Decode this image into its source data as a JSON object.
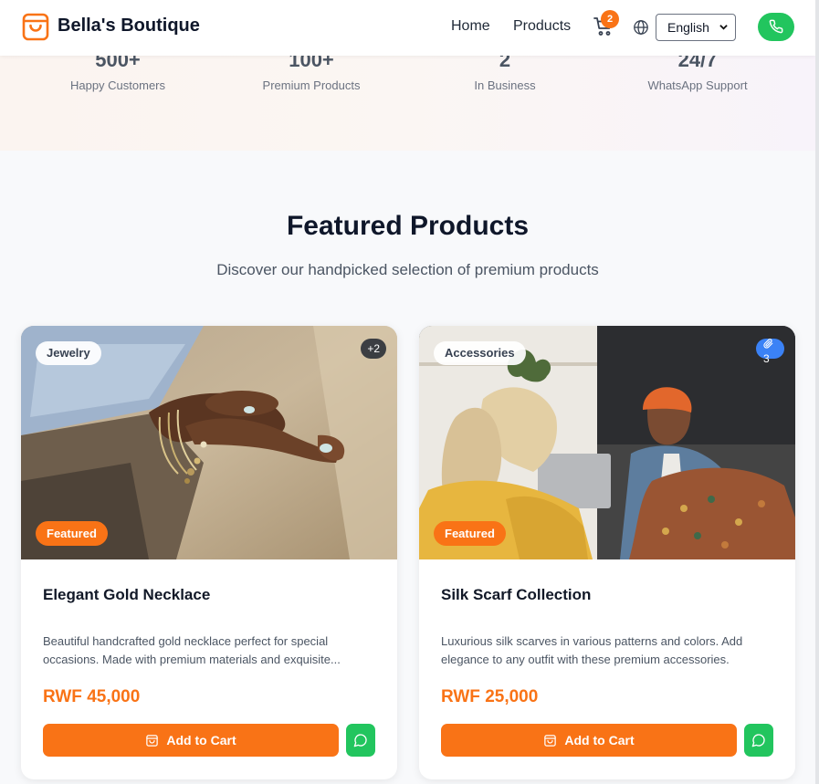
{
  "header": {
    "brand": "Bella's Boutique",
    "nav": {
      "home": "Home",
      "products": "Products"
    },
    "cart_count": "2",
    "language": {
      "selected": "English"
    },
    "colors": {
      "accent": "#f97316",
      "whatsapp": "#22c55e"
    }
  },
  "stats": [
    {
      "value": "500+",
      "label": "Happy Customers"
    },
    {
      "value": "100+",
      "label": "Premium Products"
    },
    {
      "value": "2",
      "label": "In Business"
    },
    {
      "value": "24/7",
      "label": "WhatsApp Support"
    }
  ],
  "section": {
    "title": "Featured Products",
    "subtitle": "Discover our handpicked selection of premium products"
  },
  "products": [
    {
      "category": "Jewelry",
      "image_count": "+2",
      "featured": "Featured",
      "name": "Elegant Gold Necklace",
      "description": "Beautiful handcrafted gold necklace perfect for special occasions. Made with premium materials and exquisite...",
      "price": "RWF 45,000",
      "add_to_cart": "Add to Cart"
    },
    {
      "category": "Accessories",
      "image_count": "3",
      "featured": "Featured",
      "name": "Silk Scarf Collection",
      "description": "Luxurious silk scarves in various patterns and colors. Add elegance to any outfit with these premium accessories.",
      "price": "RWF 25,000",
      "add_to_cart": "Add to Cart"
    }
  ]
}
